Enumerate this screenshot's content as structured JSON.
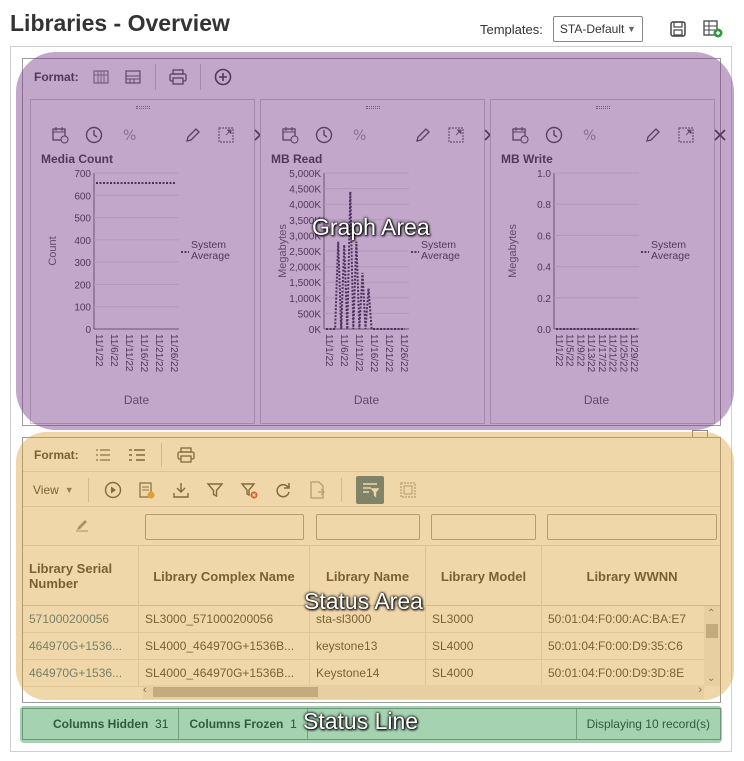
{
  "page": {
    "title": "Libraries - Overview"
  },
  "templates": {
    "label": "Templates:",
    "selected": "STA-Default"
  },
  "graph_panel": {
    "format_label": "Format:",
    "charts": [
      {
        "title": "Media Count",
        "ylabel": "Count",
        "xlabel": "Date",
        "yticks": [
          "700",
          "600",
          "500",
          "400",
          "300",
          "200",
          "100",
          "0"
        ],
        "xticks": [
          "11/1/22",
          "11/6/22",
          "11/11/22",
          "11/16/22",
          "11/21/22",
          "11/26/22"
        ],
        "legend": [
          "System",
          "Average"
        ]
      },
      {
        "title": "MB Read",
        "ylabel": "Megabytes",
        "xlabel": "Date",
        "yticks": [
          "5,000K",
          "4,500K",
          "4,000K",
          "3,500K",
          "3,000K",
          "2,500K",
          "2,000K",
          "1,500K",
          "1,000K",
          "500K",
          "0K"
        ],
        "xticks": [
          "11/1/22",
          "11/6/22",
          "11/11/22",
          "11/16/22",
          "11/21/22",
          "11/26/22"
        ],
        "legend": [
          "System",
          "Average"
        ]
      },
      {
        "title": "MB Write",
        "ylabel": "Megabytes",
        "xlabel": "Date",
        "yticks": [
          "1.0",
          "0.8",
          "0.6",
          "0.4",
          "0.2",
          "0.0"
        ],
        "xticks": [
          "11/1/22",
          "11/5/22",
          "11/9/22",
          "11/13/22",
          "11/17/22",
          "11/21/22",
          "11/25/22",
          "11/29/22"
        ],
        "legend": [
          "System",
          "Average"
        ]
      }
    ]
  },
  "chart_data": [
    {
      "type": "line",
      "title": "Media Count",
      "xlabel": "Date",
      "ylabel": "Count",
      "ylim": [
        0,
        700
      ],
      "series": [
        {
          "name": "System Average",
          "x": [
            "11/1/22",
            "11/30/22"
          ],
          "values": [
            655,
            655
          ]
        }
      ]
    },
    {
      "type": "line",
      "title": "MB Read",
      "xlabel": "Date",
      "ylabel": "Megabytes",
      "ylim": [
        0,
        5000
      ],
      "series": [
        {
          "name": "System Average",
          "x": [
            "11/1/22",
            "11/2/22",
            "11/3/22",
            "11/4/22",
            "11/5/22",
            "11/6/22",
            "11/7/22",
            "11/8/22",
            "11/9/22",
            "11/10/22",
            "11/11/22",
            "11/12/22",
            "11/13/22",
            "11/14/22",
            "11/15/22",
            "11/16/22",
            "11/17/22",
            "11/18/22",
            "11/19/22",
            "11/20/22",
            "11/21/22",
            "11/22/22",
            "11/23/22",
            "11/24/22",
            "11/25/22",
            "11/26/22",
            "11/27/22"
          ],
          "values": [
            0,
            0,
            0,
            0,
            2800,
            0,
            2700,
            0,
            4400,
            0,
            2800,
            0,
            1800,
            0,
            1300,
            0,
            0,
            0,
            0,
            0,
            0,
            0,
            0,
            0,
            0,
            0,
            0
          ]
        }
      ]
    },
    {
      "type": "line",
      "title": "MB Write",
      "xlabel": "Date",
      "ylabel": "Megabytes",
      "ylim": [
        0,
        1
      ],
      "series": [
        {
          "name": "System Average",
          "x": [
            "11/1/22",
            "11/30/22"
          ],
          "values": [
            0,
            0
          ]
        }
      ]
    }
  ],
  "table": {
    "format_label": "Format:",
    "view_label": "View",
    "columns": [
      "Library Serial Number",
      "Library Complex Name",
      "Library Name",
      "Library Model",
      "Library WWNN"
    ],
    "rows": [
      [
        "571000200056",
        "SL3000_571000200056",
        "sta-sl3000",
        "SL3000",
        "50:01:04:F0:00:AC:BA:E7"
      ],
      [
        "464970G+1536...",
        "SL4000_464970G+1536B...",
        "keystone13",
        "SL4000",
        "50:01:04:F0:00:D9:35:C6"
      ],
      [
        "464970G+1536...",
        "SL4000_464970G+1536B...",
        "Keystone14",
        "SL4000",
        "50:01:04:F0:00:D9:3D:8E"
      ]
    ]
  },
  "status_line": {
    "columns_hidden_label": "Columns Hidden",
    "columns_hidden_count": "31",
    "columns_frozen_label": "Columns Frozen",
    "columns_frozen_count": "1",
    "records": "Displaying 10 record(s)"
  },
  "annotations": {
    "graph_area": "Graph Area",
    "status_area": "Status Area",
    "status_line": "Status Line"
  },
  "colors": {
    "graph_overlay": "#7a3c8c",
    "status_overlay": "#dca032",
    "statusline_overlay": "#289646"
  }
}
